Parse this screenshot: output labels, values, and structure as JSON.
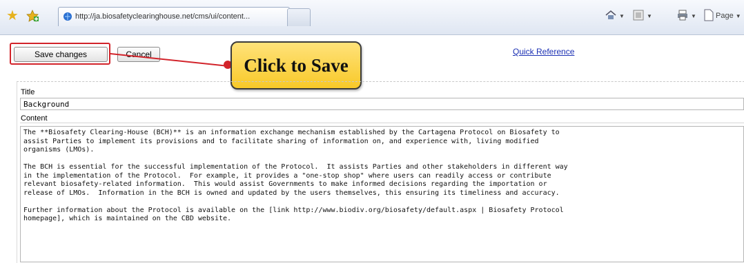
{
  "browser": {
    "tab_url": "http://ja.biosafetyclearinghouse.net/cms/ui/content...",
    "command_page_label": "Page",
    "icons": [
      "favorites-star-icon",
      "add-favorites-icon",
      "home-icon",
      "feeds-icon",
      "print-icon",
      "page-icon"
    ]
  },
  "toolbar": {
    "save_label": "Save changes",
    "cancel_label": "Cancel",
    "quick_reference": "Quick Reference"
  },
  "callout": {
    "text": "Click to Save",
    "accent": "#d2232a",
    "fill": "#f8c928"
  },
  "form": {
    "title_label": "Title",
    "title_value": "Background",
    "content_label": "Content",
    "paragraphs": [
      "The **Biosafety Clearing-House (BCH)** is an information exchange mechanism established by the Cartagena Protocol on Biosafety to\nassist Parties to implement its provisions and to facilitate sharing of information on, and experience with, living modified\norganisms (LMOs).",
      "The BCH is essential for the successful implementation of the Protocol.  It assists Parties and other stakeholders in different way\nin the implementation of the Protocol.  For example, it provides a \"one-stop shop\" where users can readily access or contribute\nrelevant biosafety-related information.  This would assist Governments to make informed decisions regarding the importation or\nrelease of LMOs.  Information in the BCH is owned and updated by the users themselves, this ensuring its timeliness and accuracy.",
      "Further information about the Protocol is available on the [link http://www.biodiv.org/biosafety/default.aspx | Biosafety Protocol\nhomepage], which is maintained on the CBD website."
    ]
  }
}
